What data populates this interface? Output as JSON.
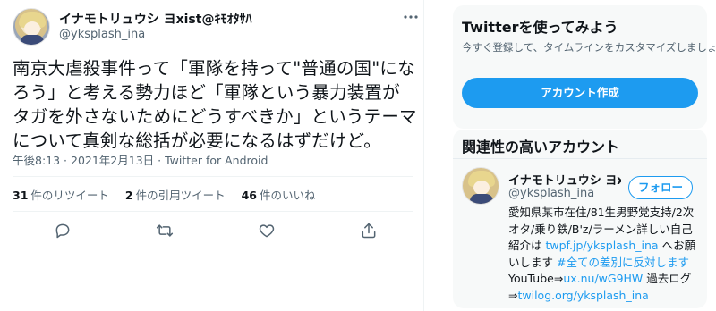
{
  "tweet": {
    "author": {
      "name": "イナモトリュウシ ヨxist@ｷﾓｵﾀｻﾊ",
      "handle": "@yksplash_ina"
    },
    "text": "南京大虐殺事件って「軍隊を持って\"普通の国\"になろう」と考える勢力ほど「軍隊という暴力装置がタガを外さないためにどうすべきか」というテーマについて真剣な総括が必要になるはずだけど。",
    "meta": "午後8:13 · 2021年2月13日 · Twitter for Android",
    "stats": {
      "retweets": {
        "count": "31",
        "label": "件のリツイート"
      },
      "quotes": {
        "count": "2",
        "label": "件の引用ツイート"
      },
      "likes": {
        "count": "46",
        "label": "件のいいね"
      }
    },
    "actions": [
      "reply-icon",
      "retweet-icon",
      "like-icon",
      "share-icon"
    ]
  },
  "signup_card": {
    "title": "Twitterを使ってみよう",
    "subtitle": "今すぐ登録して、タイムラインをカスタマイズしましょう。",
    "button_label": "アカウント作成"
  },
  "related_card": {
    "title": "関連性の高いアカウント",
    "account": {
      "name": "イナモトリュウシ ヨxist@ｷﾓｵﾀｻﾊ",
      "handle": "@yksplash_ina",
      "follow_label": "フォロー",
      "bio_1": "愛知県某市在住/81生男野党支持/2次オタ/乗り鉄/B'z/ラーメン詳しい自己紹介は ",
      "bio_link_1": "twpf.jp/yksplash_ina",
      "bio_2": " へお願いします ",
      "bio_hashtag": "#全ての差別に反対します",
      "bio_3": " YouTube⇒",
      "bio_link_2": "ux.nu/wG9HW",
      "bio_4": " 過去ログ⇒",
      "bio_link_3": "twilog.org/yksplash_ina"
    }
  },
  "colors": {
    "accent": "#1d9bf0",
    "text": "#0f1419",
    "secondary": "#536471",
    "card_bg": "#f7f9f9"
  }
}
